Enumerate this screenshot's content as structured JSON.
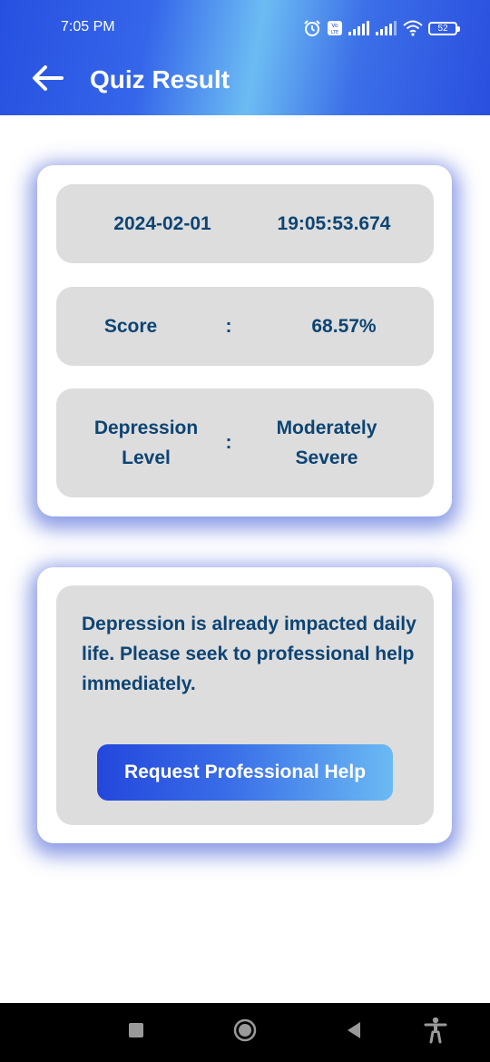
{
  "status_bar": {
    "time": "7:05 PM",
    "battery": "52",
    "icons": [
      "alarm-icon",
      "volte-icon",
      "signal-icon",
      "signal-icon",
      "wifi-icon",
      "battery-icon"
    ]
  },
  "header": {
    "title": "Quiz Result",
    "back_icon": "arrow-left-icon"
  },
  "result": {
    "date": "2024-02-01",
    "time": "19:05:53.674",
    "score_label": "Score",
    "separator": ":",
    "score_value": "68.57%",
    "level_label_line1": "Depression",
    "level_label_line2": "Level",
    "level_value_line1": "Moderately",
    "level_value_line2": "Severe"
  },
  "advice": {
    "message": "Depression is already impacted daily life. Please seek to professional help immediately.",
    "button_label": "Request Professional Help"
  },
  "nav_bar": {
    "icons": [
      "recents-icon",
      "home-icon",
      "back-icon",
      "accessibility-icon"
    ]
  },
  "colors": {
    "header_primary": "#2a4fdf",
    "header_highlight": "#6cbcf3",
    "panel_bg": "#dddddd",
    "text": "#0d4474"
  }
}
